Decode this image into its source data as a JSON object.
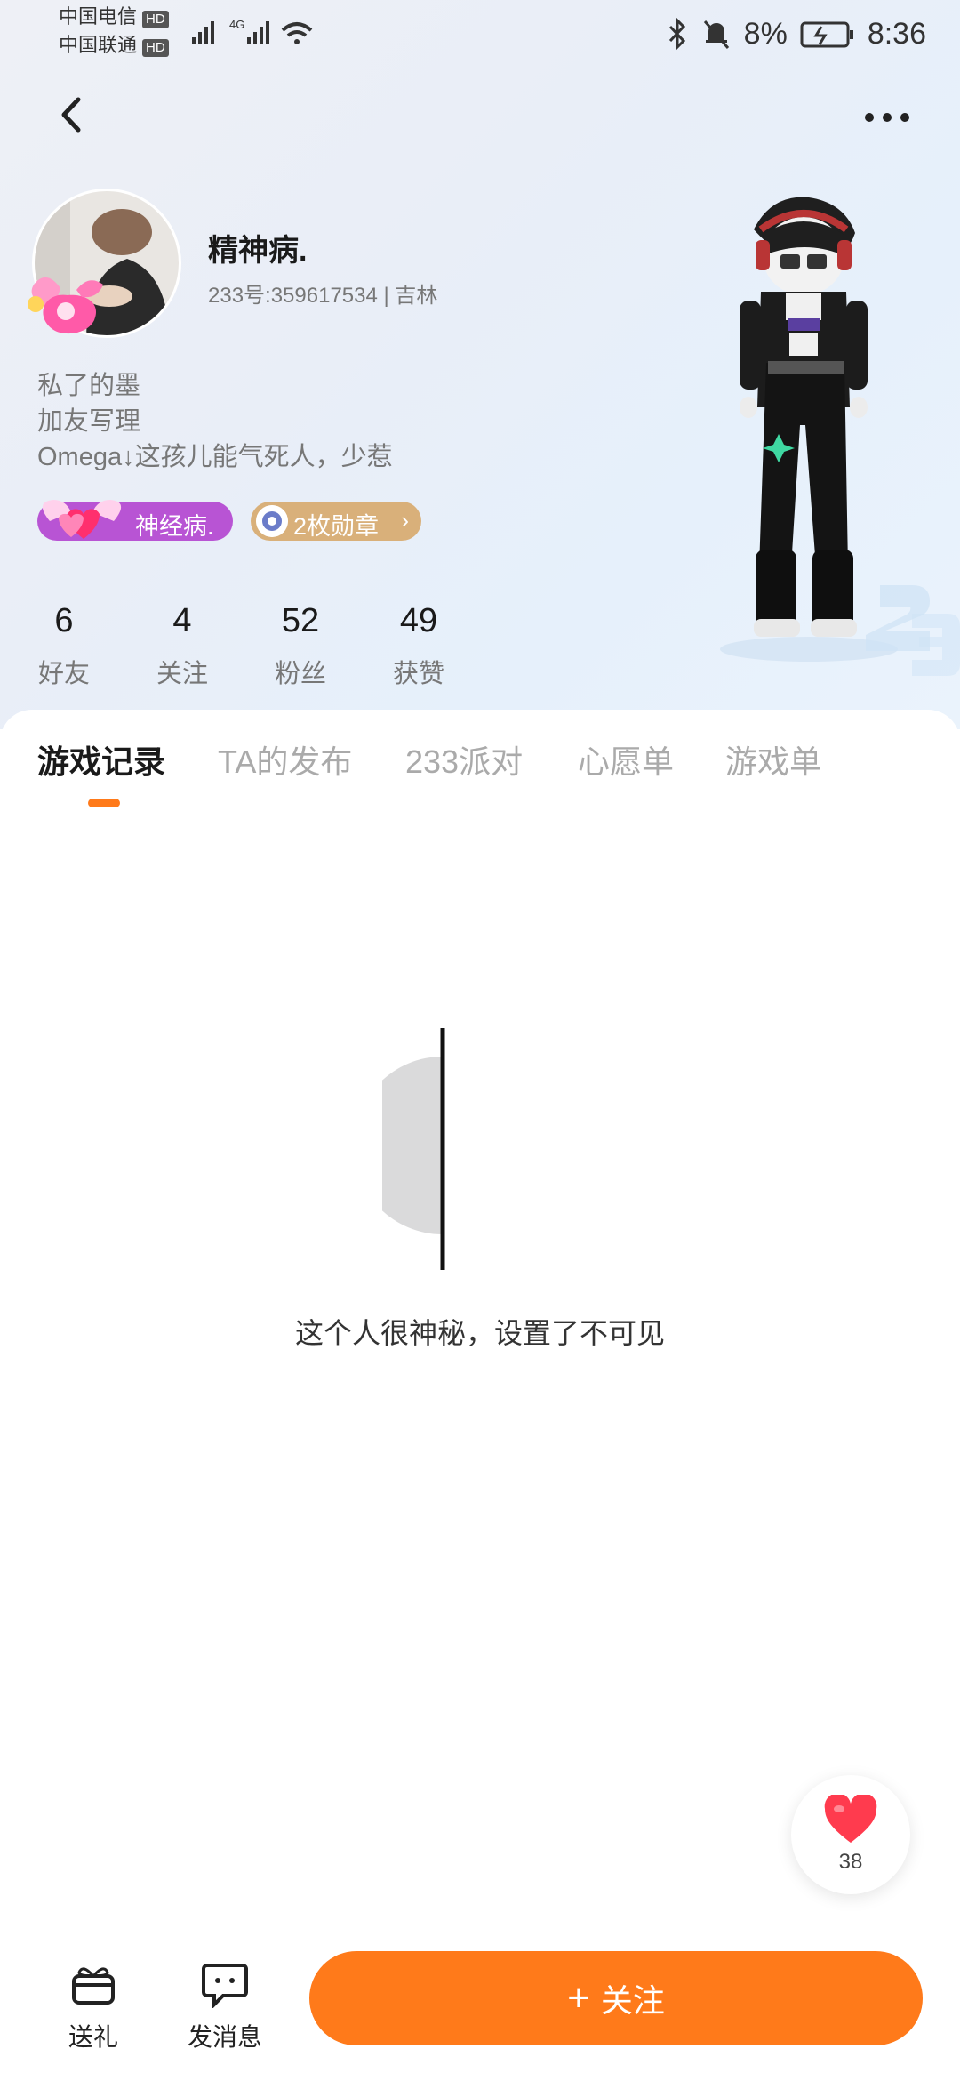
{
  "status_bar": {
    "carrier1": "中国电信",
    "carrier2": "中国联通",
    "hd_badge": "HD",
    "network": "4G",
    "battery": "8%",
    "time": "8:36"
  },
  "profile": {
    "username": "精神病.",
    "uid_line": "233号:359617534 | 吉林",
    "bio_lines": [
      "私了的墨",
      "加友写理",
      "Omega↓这孩儿能气死人，少惹"
    ],
    "tag_title": "神经病.",
    "tag_badges": "2枚勋章"
  },
  "stats": [
    {
      "num": "6",
      "label": "好友"
    },
    {
      "num": "4",
      "label": "关注"
    },
    {
      "num": "52",
      "label": "粉丝"
    },
    {
      "num": "49",
      "label": "获赞"
    }
  ],
  "tabs": [
    "游戏记录",
    "TA的发布",
    "233派对",
    "心愿单",
    "游戏单"
  ],
  "active_tab": 0,
  "empty_state": {
    "message": "这个人很神秘，设置了不可见"
  },
  "like_count": "38",
  "bottom_bar": {
    "gift_label": "送礼",
    "message_label": "发消息",
    "follow_label": "关注"
  },
  "colors": {
    "accent": "#ff7a1a",
    "tag_pink": "#b854d4",
    "tag_gold": "#d9b07a"
  },
  "icons": {
    "back": "chevron-left-icon",
    "more": "more-dots-icon",
    "like": "heart-icon",
    "gift": "gift-icon",
    "message": "chat-bubble-icon"
  }
}
